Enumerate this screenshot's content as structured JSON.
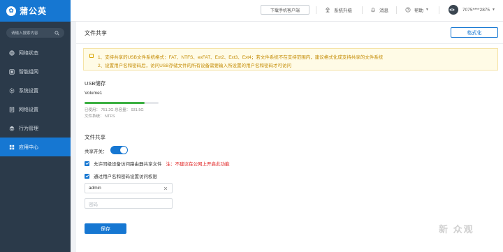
{
  "app": {
    "brand": "蒲公英",
    "search_placeholder": "请输入搜索内容"
  },
  "sidebar": {
    "items": [
      {
        "label": "网络状态",
        "icon": "globe-icon"
      },
      {
        "label": "智能组网",
        "icon": "network-icon"
      },
      {
        "label": "系统设置",
        "icon": "gear-icon"
      },
      {
        "label": "网络设置",
        "icon": "document-icon"
      },
      {
        "label": "行为管理",
        "icon": "stack-icon"
      },
      {
        "label": "应用中心",
        "icon": "grid-icon",
        "active": true
      }
    ]
  },
  "header": {
    "download_label": "下载手机客户端",
    "upgrade_label": "系统升级",
    "messages_label": "消息",
    "help_label": "帮助",
    "user_label": "7075****2875"
  },
  "page": {
    "title": "文件共享",
    "format_label": "格式化",
    "notice_lines": [
      "1、支持共享的USB文件系统格式：FAT、NTFS、exFAT、Ext2、Ext3、Ext4；若文件系统不在支持范围内，建议格式化成支持共享的文件系统",
      "2、设置用户名和密码后，访问USB存储文件的所有设备需要输入所设置的用户名和密码才可访问"
    ],
    "usb_title": "USB储存",
    "volume_name": "Volume1",
    "used_fraction": 0.81,
    "used_text": "已使用： 751.2G    总容量： 931.5G",
    "fs_text": "文件系统： NTFS",
    "share_title": "文件共享",
    "toggle_label": "共享开关：",
    "toggle_on": true,
    "opt1_label": "允许同级设备访问路由器共享文件",
    "opt1_warning": "注：不建议在公网上开启此功能",
    "opt1_checked": true,
    "opt2_label": "通过用户名和密码设置访问权限",
    "opt2_checked": true,
    "username_value": "admin",
    "password_placeholder": "密码",
    "save_label": "保存"
  },
  "watermark": "新 众观"
}
